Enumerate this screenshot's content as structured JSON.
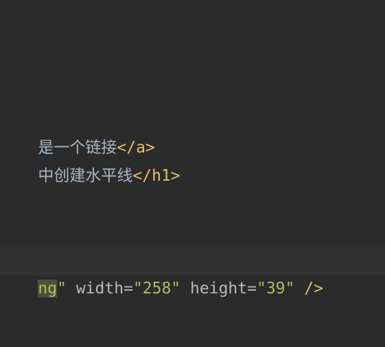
{
  "code_lines": [
    {
      "text": "是一个链接",
      "close_tag": "</a>"
    },
    {
      "text": "中创建水平线",
      "close_tag": "</h1>"
    },
    {
      "highlight": "ng",
      "quote_close": "\"",
      "attr1_name": "width",
      "eq": "=",
      "attr1_value": "\"258\"",
      "attr2_name": "height",
      "attr2_value": "\"39\"",
      "self_close": "/>"
    }
  ],
  "colors": {
    "background": "#2b2b2b",
    "current_line": "#323232",
    "tag": "#e8bf6a",
    "string": "#a5c25c",
    "attribute": "#bababa",
    "text": "#a9b7c6",
    "match_highlight": "#52503a"
  }
}
